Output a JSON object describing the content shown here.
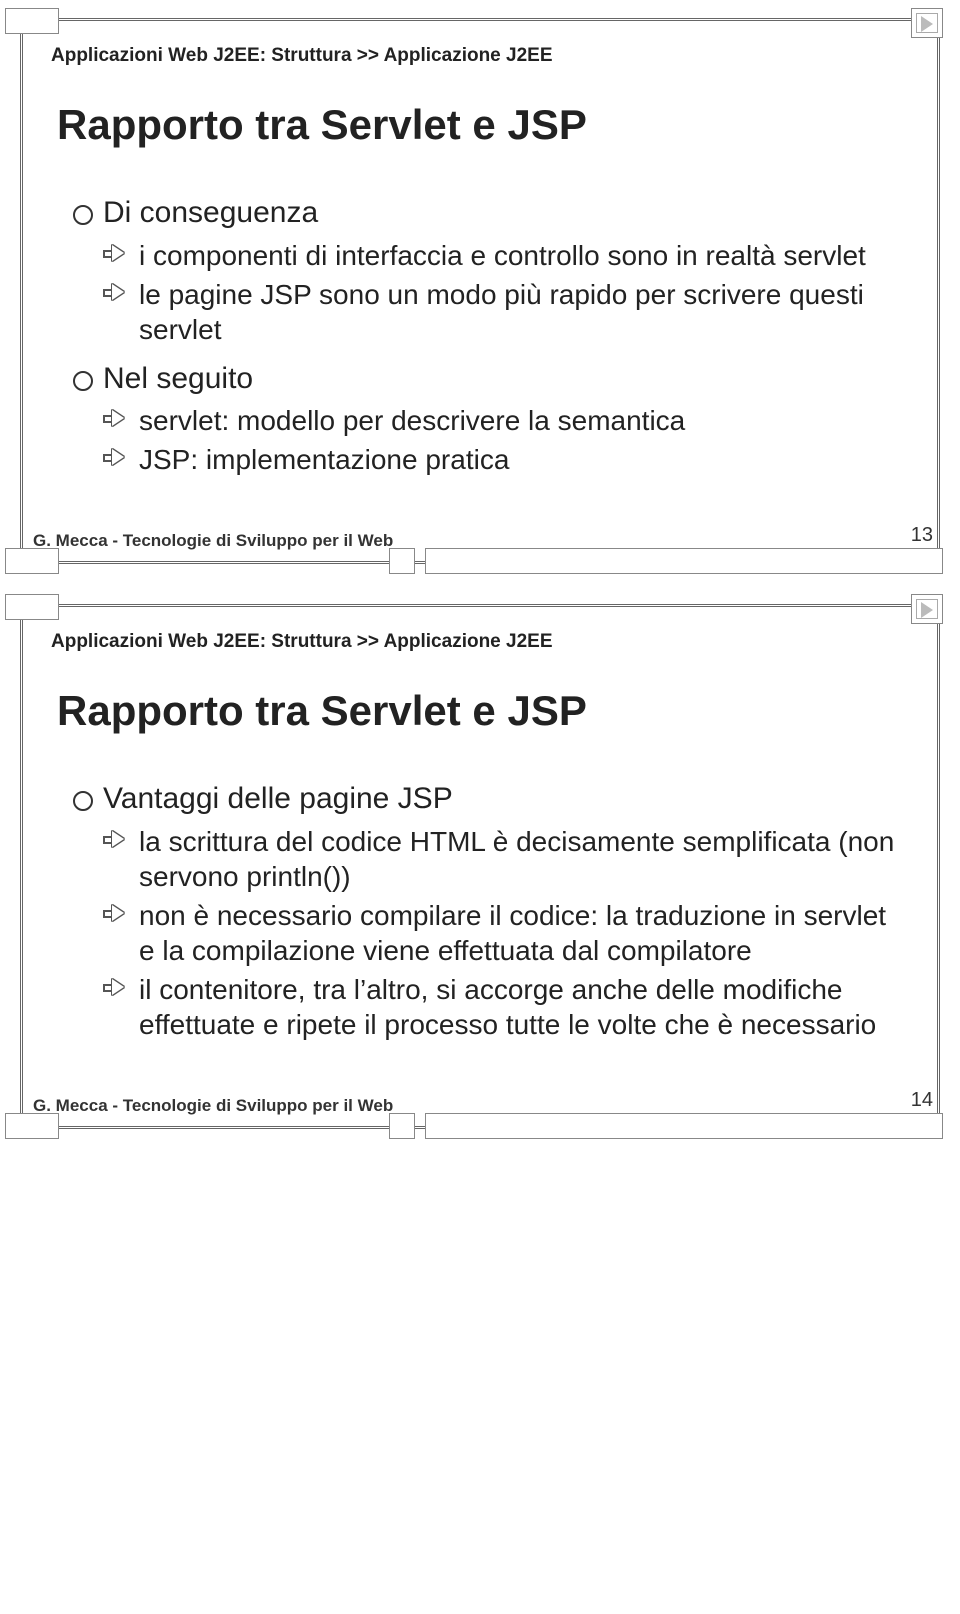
{
  "footer_credit": "G. Mecca - Tecnologie di Sviluppo per il Web",
  "slides": [
    {
      "breadcrumb": "Applicazioni Web J2EE: Struttura >> Applicazione J2EE",
      "title": "Rapporto tra Servlet e JSP",
      "page": "13",
      "bullets": [
        {
          "label": "Di conseguenza",
          "sub": [
            "i componenti di interfaccia e controllo sono in realtà servlet",
            "le pagine JSP sono un modo più rapido per scrivere questi servlet"
          ]
        },
        {
          "label": "Nel seguito",
          "sub": [
            "servlet: modello per descrivere la semantica",
            "JSP: implementazione pratica"
          ]
        }
      ]
    },
    {
      "breadcrumb": "Applicazioni Web J2EE: Struttura >> Applicazione J2EE",
      "title": "Rapporto tra Servlet e JSP",
      "page": "14",
      "bullets": [
        {
          "label": "Vantaggi delle pagine JSP",
          "sub": [
            "la scrittura del codice HTML è decisamente semplificata (non servono println())",
            "non è necessario compilare il codice: la traduzione in servlet e la compilazione viene effettuata dal compilatore",
            "il contenitore, tra l’altro, si accorge anche delle modifiche effettuate e ripete il processo tutte le volte che è necessario"
          ]
        }
      ]
    }
  ]
}
